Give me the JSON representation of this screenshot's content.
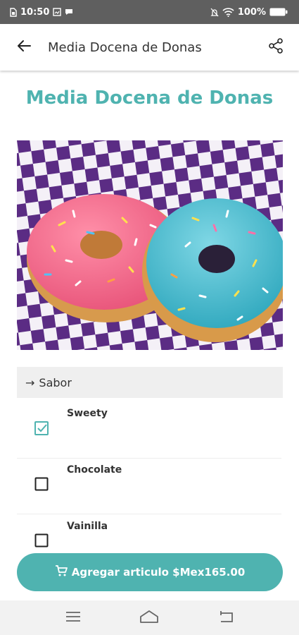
{
  "status_bar": {
    "time": "10:50",
    "battery": "100%"
  },
  "app_bar": {
    "title": "Media Docena de Donas"
  },
  "product": {
    "title": "Media Docena de Donas"
  },
  "options_section": {
    "header_arrow": "→",
    "header_label": "Sabor",
    "items": [
      {
        "label": "Sweety",
        "checked": true
      },
      {
        "label": "Chocolate",
        "checked": false
      },
      {
        "label": "Vainilla",
        "checked": false
      }
    ]
  },
  "cart_button": {
    "label": "Agregar articulo $Mex165.00"
  },
  "colors": {
    "accent": "#4fb3b0",
    "status_bar": "#5f5f5f"
  },
  "icons": {
    "back": "arrow-left-icon",
    "share": "share-icon",
    "cart": "cart-icon",
    "nav_menu": "menu-icon",
    "nav_home": "home-icon",
    "nav_back": "back-nav-icon"
  }
}
